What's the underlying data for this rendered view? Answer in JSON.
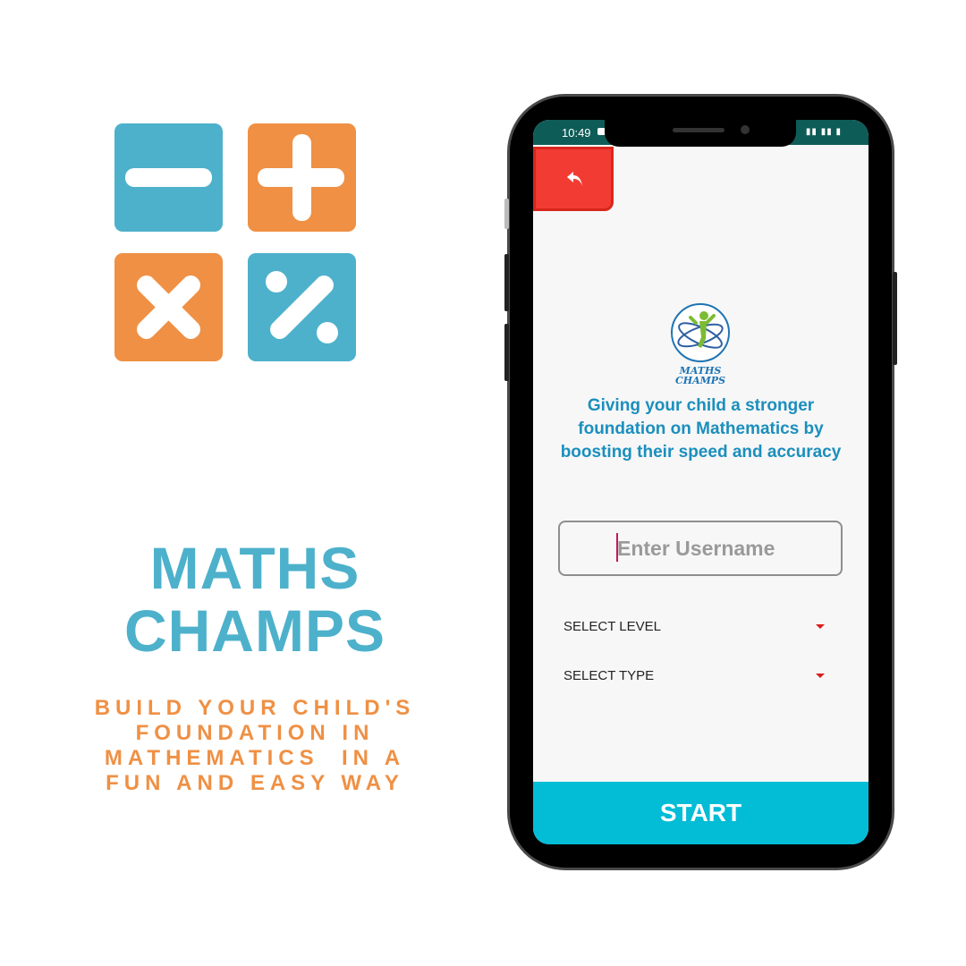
{
  "brand": {
    "title_line1": "MATHS",
    "title_line2": "CHAMPS",
    "subtitle_lines": [
      "BUILD YOUR CHILD'S",
      "FOUNDATION IN",
      "MATHEMATICS  IN A",
      "FUN AND EASY WAY"
    ]
  },
  "icons": {
    "minus": "minus-icon",
    "plus": "plus-icon",
    "times": "multiply-icon",
    "percent": "percent-icon"
  },
  "colors": {
    "blue": "#4db1cb",
    "orange": "#ef9044",
    "back_button": "#f23c33",
    "start_button": "#03bcd6",
    "tagline": "#1b8fbd"
  },
  "status_bar": {
    "time": "10:49"
  },
  "app": {
    "logo_text_line1": "MATHS",
    "logo_text_line2": "CHAMPS",
    "tagline": "Giving your child a stronger foundation on Mathematics by boosting their speed and accuracy",
    "username_placeholder": "Enter Username",
    "select_level": "SELECT LEVEL",
    "select_type": "SELECT TYPE",
    "start_label": "START"
  }
}
